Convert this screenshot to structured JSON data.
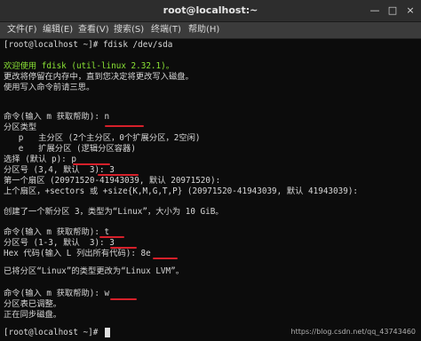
{
  "window": {
    "title": "root@localhost:~",
    "minimize_label": "—",
    "maximize_label": "□",
    "close_label": "×"
  },
  "menu": [
    "文件(F)",
    "编辑(E)",
    "查看(V)",
    "搜索(S)",
    "终端(T)",
    "帮助(H)"
  ],
  "terminal_lines": [
    "[root@localhost ~]# fdisk /dev/sda",
    "",
    "欢迎使用 fdisk (util-linux 2.32.1)。",
    "更改将停留在内存中，直到您决定将更改写入磁盘。",
    "使用写入命令前请三思。",
    "",
    "",
    "命令(输入 m 获取帮助): n",
    "分区类型",
    "   p   主分区 (2个主分区，0个扩展分区，2空闲)",
    "   e   扩展分区 (逻辑分区容器)",
    "选择 (默认 p): p",
    "分区号 (3,4, 默认  3): 3",
    "第一个扇区 (20971520-41943039, 默认 20971520):",
    "上个扇区，+sectors 或 +size{K,M,G,T,P} (20971520-41943039, 默认 41943039):",
    "",
    "创建了一个新分区 3，类型为“Linux”，大小为 10 GiB。",
    "",
    "命令(输入 m 获取帮助): t",
    "分区号 (1-3, 默认  3): 3",
    "Hex 代码(输入 L 列出所有代码): 8e",
    "",
    "已将分区“Linux”的类型更改为“Linux LVM”。",
    "",
    "命令(输入 m 获取帮助): w",
    "分区表已调整。",
    "正在同步磁盘。",
    "",
    "[root@localhost ~]# "
  ],
  "watermark": "https://blog.csdn.net/qq_43743460",
  "colors": {
    "terminal_bg": "#0c0c0c",
    "terminal_fg": "#d8d8d8",
    "welcome_green": "#8ae234",
    "annotation_red": "#d6202a"
  }
}
